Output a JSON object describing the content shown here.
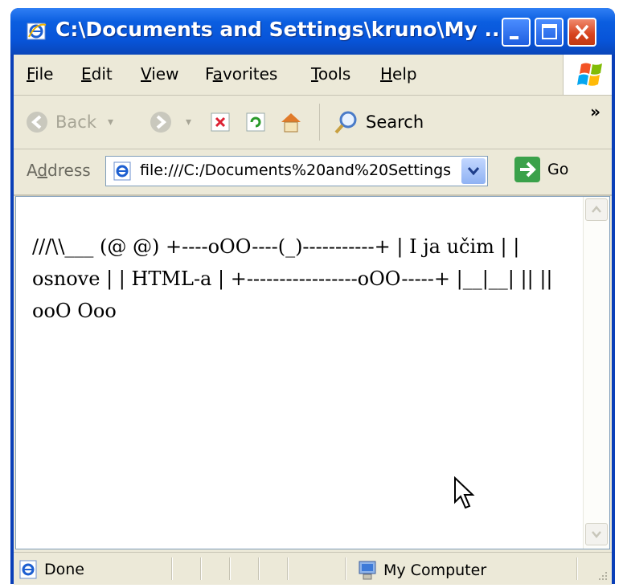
{
  "window": {
    "title": "C:\\Documents and Settings\\kruno\\My ..."
  },
  "menu": [
    {
      "label": "File",
      "mnemonic": "F",
      "rest": "ile"
    },
    {
      "label": "Edit",
      "mnemonic": "E",
      "rest": "dit"
    },
    {
      "label": "View",
      "mnemonic": "V",
      "rest": "iew"
    },
    {
      "label": "Favorites",
      "pre": "F",
      "mnemonic": "a",
      "rest": "vorites"
    },
    {
      "label": "Tools",
      "mnemonic": "T",
      "rest": "ools"
    },
    {
      "label": "Help",
      "mnemonic": "H",
      "rest": "elp"
    }
  ],
  "toolbar": {
    "back_label": "Back",
    "search_label": "Search",
    "more": "»"
  },
  "address": {
    "label_pre": "A",
    "label_mnemonic": "d",
    "label_rest": "dress",
    "url": "file:///C:/Documents%20and%20Settings",
    "go_label": "Go"
  },
  "page": {
    "text": "///\\\\___ (@ @) +----oOO----(_)-----------+ | I ja učim | | osnove | | HTML-a | +-----------------oOO-----+ |__|__| || || ooO Ooo"
  },
  "status": {
    "left": "Done",
    "zone": "My Computer"
  },
  "colors": {
    "titlebar": "#0b5ee0",
    "close_button": "#d6421d",
    "chrome": "#ece9d8"
  }
}
